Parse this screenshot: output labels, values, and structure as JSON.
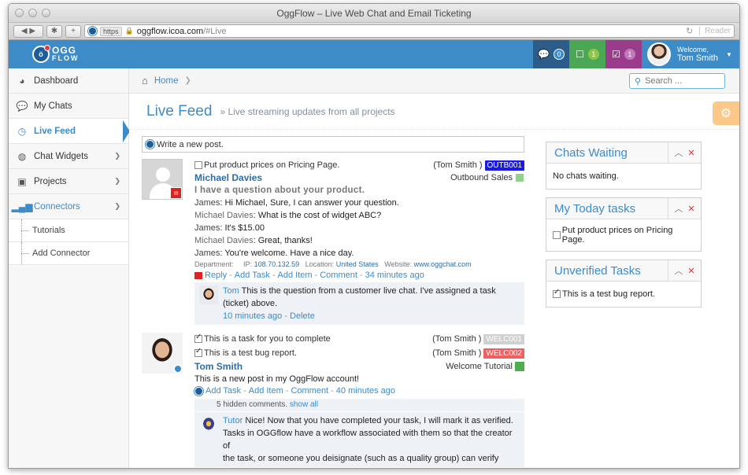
{
  "window": {
    "title": "OggFlow – Live Web Chat and Email Ticketing",
    "url_scheme": "https",
    "url_host": "oggflow.icoa.com",
    "url_path": "/#Live",
    "reader_label": "Reader"
  },
  "header": {
    "logo_top": "OGG",
    "logo_bottom": "FLOW",
    "chats_count": "0",
    "tickets_count": "1",
    "tasks_count": "1",
    "welcome": "Welcome,",
    "user_name": "Tom Smith",
    "colors": {
      "bar": "#3d8bc7",
      "chats_box": "#2c5d8a",
      "tickets_box": "#4aa855",
      "tasks_box": "#9b3b8c"
    }
  },
  "sidebar": {
    "items": [
      {
        "label": "Dashboard",
        "icon": "dashboard-icon"
      },
      {
        "label": "My Chats",
        "icon": "chat-bubbles-icon"
      },
      {
        "label": "Live Feed",
        "icon": "clock-icon"
      },
      {
        "label": "Chat Widgets",
        "icon": "globe-icon"
      },
      {
        "label": "Projects",
        "icon": "briefcase-icon"
      },
      {
        "label": "Connectors",
        "icon": "signal-bars-icon"
      }
    ],
    "connectors_sub": [
      "Tutorials",
      "Add Connector"
    ]
  },
  "breadcrumb": {
    "home": "Home"
  },
  "search": {
    "placeholder": "Search ..."
  },
  "page": {
    "title": "Live Feed",
    "subtitle": "» Live streaming updates from all projects"
  },
  "newpost": {
    "placeholder": "Write a new post."
  },
  "posts": [
    {
      "task": "Put product prices on Pricing Page.",
      "task_owner": "(Tom Smith )",
      "task_tag": "OUTB001",
      "author": "Michael Davies",
      "project": "Outbound Sales",
      "subject": "I have a question about your  product.",
      "lines": [
        {
          "who": "James",
          "text": ": Hi Michael, Sure, I can answer your question."
        },
        {
          "who": "Michael Davies",
          "text": ": What is the cost of widget ABC?"
        },
        {
          "who": "James",
          "text": ": It's $15.00"
        },
        {
          "who": "Michael Davies",
          "text": ": Great, thanks!"
        },
        {
          "who": "James",
          "text": ": You're welcome. Have a nice day."
        }
      ],
      "meta": {
        "dept_label": "Department:",
        "ip_label": "IP:",
        "ip": "108.70.132.59",
        "loc_label": "Location:",
        "location": "United States",
        "web_label": "Website:",
        "website": "www.oggchat.com"
      },
      "actions": {
        "reply": "Reply",
        "add_task": "Add Task",
        "add_item": "Add Item",
        "comment": "Comment",
        "time": "34 minutes ago",
        "sep": "-"
      },
      "comment": {
        "name": "Tom",
        "text": " This is the question from a customer live chat. I've assigned a task (ticket) above.",
        "time": "10 minutes ago",
        "sep": "-",
        "delete": "Delete"
      }
    },
    {
      "tasks": [
        {
          "text": "This is a task for you to complete",
          "owner": "(Tom Smith )",
          "tag": "WELC001"
        },
        {
          "text": "This is a test bug report.",
          "owner": "(Tom Smith )",
          "tag": "WELC002"
        }
      ],
      "author": "Tom Smith",
      "project": "Welcome Tutorial",
      "body": "This is a new post in my OggFlow account!",
      "actions": {
        "add_task": "Add Task",
        "add_item": "Add Item",
        "comment": "Comment",
        "time": "40 minutes ago",
        "sep": "-"
      },
      "hidden": {
        "text": "5 hidden comments.",
        "show_all": "show all"
      },
      "comment": {
        "name": "Tutor",
        "line1": " Nice! Now that you have completed your task, I will mark it as verified.",
        "line2": "Tasks in OGGflow have a workflow associated with them so that the creator of",
        "line3": "the task, or someone you deisignate (such as a quality group) can verify"
      }
    }
  ],
  "widgets": {
    "chats_waiting": {
      "title": "Chats Waiting",
      "body": "No chats waiting."
    },
    "today_tasks": {
      "title": "My Today tasks",
      "item": "Put product prices on Pricing Page."
    },
    "unverified": {
      "title": "Unverified Tasks",
      "item": "This is a test bug report."
    }
  }
}
